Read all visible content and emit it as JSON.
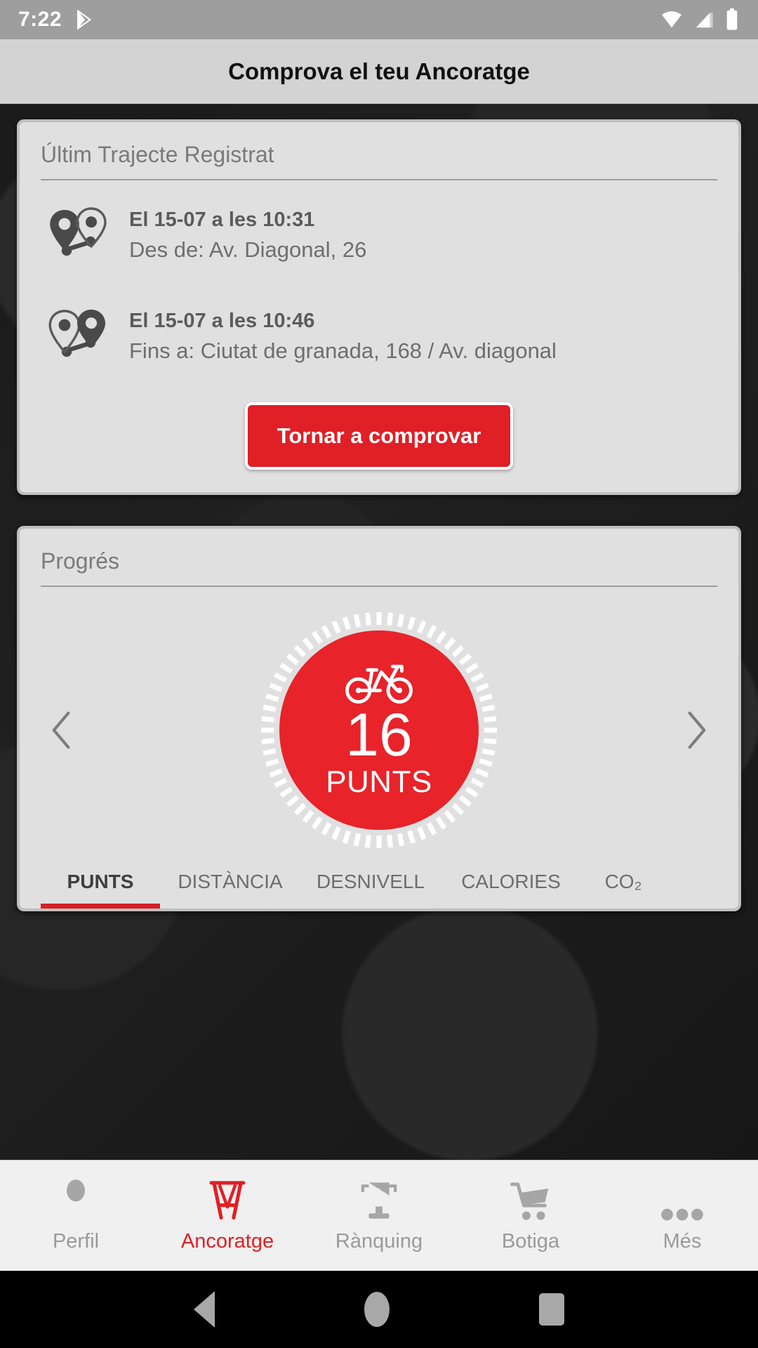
{
  "status_bar": {
    "time": "7:22",
    "icons": [
      "play-store-icon",
      "wifi-icon",
      "cellular-signal-icon",
      "battery-icon"
    ]
  },
  "header": {
    "title": "Comprova el teu Ancoratge"
  },
  "trip_card": {
    "title": "Últim Trajecte Registrat",
    "rows": [
      {
        "icon": "origin-pin-icon",
        "when": "El 15-07 a les 10:31",
        "where": "Des de: Av. Diagonal, 26"
      },
      {
        "icon": "destination-pin-icon",
        "when": "El 15-07 a les 10:46",
        "where": "Fins a: Ciutat de granada, 168 / Av. diagonal"
      }
    ],
    "button_label": "Tornar a comprovar"
  },
  "progress_card": {
    "title": "Progrés",
    "prev_label": "‹",
    "next_label": "›",
    "gauge": {
      "icon": "bicycle-icon",
      "value": "16",
      "unit": "PUNTS"
    },
    "tabs": [
      {
        "label": "PUNTS",
        "active": true
      },
      {
        "label": "DISTÀNCIA",
        "active": false
      },
      {
        "label": "DESNIVELL",
        "active": false
      },
      {
        "label": "CALORIES",
        "active": false
      },
      {
        "label": "CO₂",
        "active": false
      }
    ]
  },
  "bottom_nav": [
    {
      "label": "Perfil",
      "icon": "person-icon",
      "active": false
    },
    {
      "label": "Ancoratge",
      "icon": "docking-station-icon",
      "active": true
    },
    {
      "label": "Rànquing",
      "icon": "trophy-icon",
      "active": false
    },
    {
      "label": "Botiga",
      "icon": "shopping-cart-icon",
      "active": false
    },
    {
      "label": "Més",
      "icon": "more-dots-icon",
      "active": false
    }
  ],
  "android_nav": [
    "back-button",
    "home-button",
    "recents-button"
  ],
  "colors": {
    "accent_red": "#e01f26",
    "gauge_red": "#e8232a",
    "card_bg": "#e0e0e0",
    "card_frame": "#bfbfbf",
    "header_bg": "#d3d3d3",
    "statusbar_bg": "#9e9e9e",
    "body_dark": "#1c1c1c"
  }
}
